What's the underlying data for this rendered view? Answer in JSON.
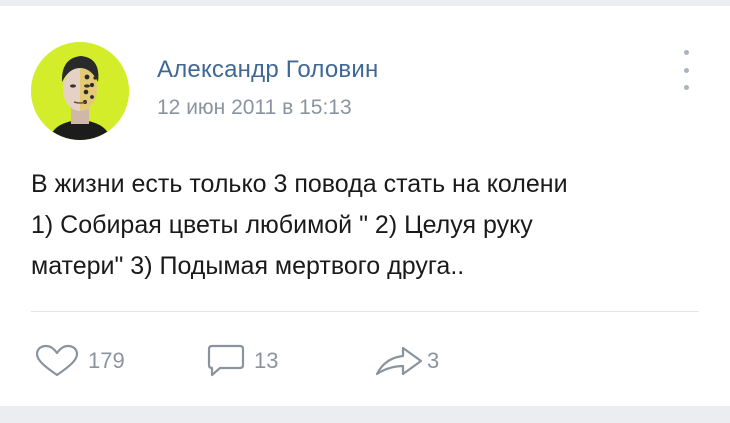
{
  "post": {
    "author": "Александр Головин",
    "date": "12 июн 2011 в 15:13",
    "text_lines": [
      "В жизни есть только 3 повода стать на колени",
      "1) Собирая цветы любимой \" 2) Целуя руку",
      "матери\" 3) Подымая мертвого друга.."
    ]
  },
  "actions": {
    "likes": "179",
    "comments": "13",
    "shares": "3"
  },
  "icons": {
    "menu": "more-vertical-icon",
    "like": "heart-icon",
    "comment": "comment-icon",
    "share": "share-arrow-icon"
  },
  "colors": {
    "author": "#3f6896",
    "secondary": "#8a949e",
    "avatar_bg": "#d4ed2b"
  }
}
